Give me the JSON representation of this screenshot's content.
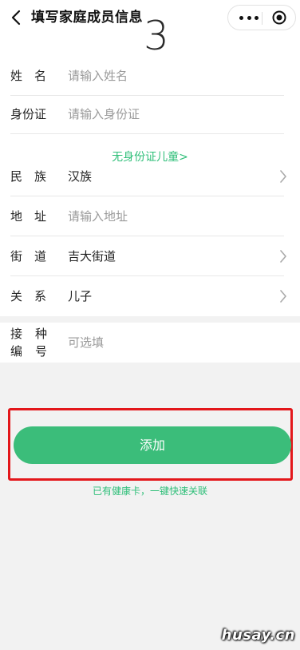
{
  "header": {
    "title": "填写家庭成员信息",
    "step": "3",
    "back_icon": "chevron-left-icon",
    "more_icon": "more-dots-icon",
    "close_icon": "target-close-icon"
  },
  "form": {
    "name": {
      "label": "姓　名",
      "placeholder": "请输入姓名"
    },
    "id_card": {
      "label": "身份证",
      "placeholder": "请输入身份证"
    },
    "no_id_link": "无身份证儿童>",
    "ethnicity": {
      "label": "民　族",
      "value": "汉族"
    },
    "address": {
      "label": "地　址",
      "placeholder": "请输入地址"
    },
    "street": {
      "label": "街　道",
      "value": "吉大街道"
    },
    "relation": {
      "label": "关　系",
      "value": "儿子"
    },
    "vaccine_code": {
      "label_line1": "接种",
      "label_line2": "编号",
      "placeholder": "可选填"
    }
  },
  "actions": {
    "add_label": "添加",
    "health_card_link": "已有健康卡，一键快速关联"
  },
  "watermark": "husay.cn",
  "colors": {
    "accent": "#3bbd7a",
    "link": "#2fbf79",
    "highlight": "#e3171b"
  }
}
